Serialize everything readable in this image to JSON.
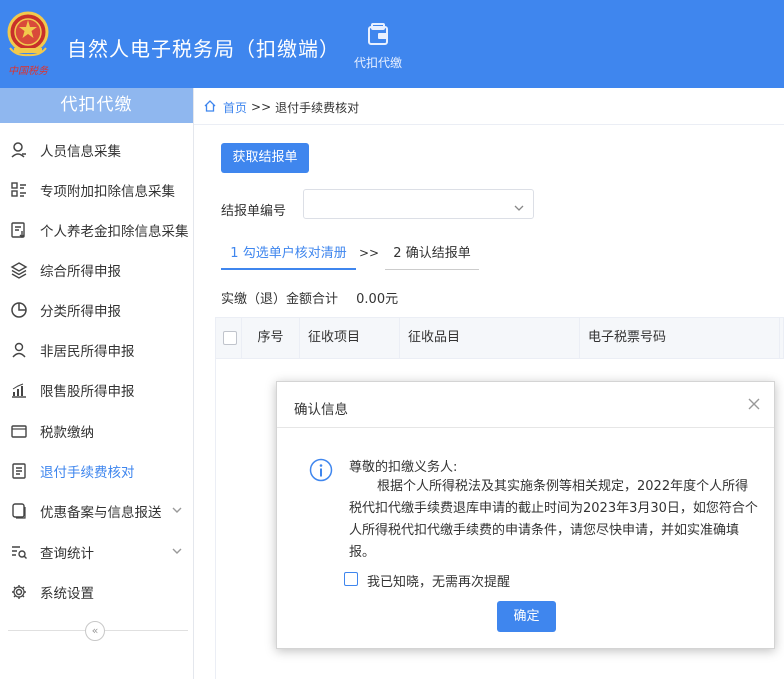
{
  "header": {
    "app_title": "自然人电子税务局（扣缴端）",
    "nav_label": "代扣代缴",
    "emblem_text": "中国税务",
    "emblem_icon": "tax-emblem-icon",
    "nav_icon": "wallet-icon",
    "bg_color": "#3f86ee"
  },
  "sidebar": {
    "title": "代扣代缴",
    "collapse_glyph": "«",
    "items": [
      {
        "label": "人员信息采集",
        "icon": "person-icon"
      },
      {
        "label": "专项附加扣除信息采集",
        "icon": "grid-list-icon"
      },
      {
        "label": "个人养老金扣除信息采集",
        "icon": "document-download-icon"
      },
      {
        "label": "综合所得申报",
        "icon": "layers-icon"
      },
      {
        "label": "分类所得申报",
        "icon": "pie-chart-icon"
      },
      {
        "label": "非居民所得申报",
        "icon": "person-outline-icon"
      },
      {
        "label": "限售股所得申报",
        "icon": "bar-chart-icon"
      },
      {
        "label": "税款缴纳",
        "icon": "folder-icon"
      },
      {
        "label": "退付手续费核对",
        "icon": "list-document-icon",
        "active": true
      },
      {
        "label": "优惠备案与信息报送",
        "icon": "copy-icon",
        "expandable": true
      },
      {
        "label": "查询统计",
        "icon": "search-list-icon",
        "expandable": true
      },
      {
        "label": "系统设置",
        "icon": "gear-icon"
      }
    ]
  },
  "breadcrumb": {
    "home": "首页",
    "separator": ">>",
    "current": "退付手续费核对"
  },
  "main": {
    "fetch_button": "获取结报单",
    "report_no_label": "结报单编号",
    "report_no_value": "",
    "steps": {
      "step1": "1 勾选单户核对清册",
      "arrow": ">>",
      "step2": "2 确认结报单"
    },
    "total_label": "实缴（退）金额合计",
    "total_value": "0.00元",
    "table_headers": [
      "序号",
      "征收项目",
      "征收品目",
      "电子税票号码"
    ]
  },
  "dialog": {
    "title": "确认信息",
    "greeting": "尊敬的扣缴义务人:",
    "message": "根据个人所得税法及其实施条例等相关规定，2022年度个人所得税代扣代缴手续费退库申请的截止时间为2023年3月30日，如您符合个人所得税代扣代缴手续费的申请条件，请您尽快申请，并如实准确填报。",
    "checkbox_label": "我已知晓，无需再次提醒",
    "checkbox_checked": false,
    "confirm_button": "确定"
  },
  "colors": {
    "accent": "#3f86ee",
    "sidebar_head": "#8fb7ef"
  }
}
